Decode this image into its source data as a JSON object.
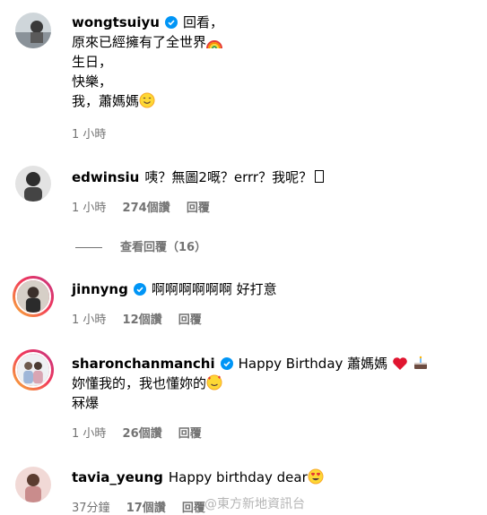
{
  "comments": [
    {
      "username": "wongtsuiyu",
      "verified": true,
      "lines": [
        "回看，",
        "原來已經擁有了全世界",
        "生日，",
        "快樂，",
        "我，蕭媽媽"
      ],
      "time": "1 小時",
      "likes": "",
      "reply": ""
    },
    {
      "username": "edwinsiu",
      "verified": false,
      "text": "咦？無圖2嘅？errr？我呢？",
      "time": "1 小時",
      "likes": "274個讚",
      "reply": "回覆",
      "view_replies": "查看回覆（16）"
    },
    {
      "username": "jinnyng",
      "verified": true,
      "text": "啊啊啊啊啊啊 好打意",
      "time": "1 小時",
      "likes": "12個讚",
      "reply": "回覆"
    },
    {
      "username": "sharonchanmanchi",
      "verified": true,
      "text": "Happy Birthday 蕭媽媽",
      "lines2": [
        "妳懂我的，我也懂妳的",
        "冧爆"
      ],
      "time": "1 小時",
      "likes": "26個讚",
      "reply": "回覆"
    },
    {
      "username": "tavia_yeung",
      "verified": false,
      "text": "Happy birthday dear",
      "time": "37分鐘",
      "likes": "17個讚",
      "reply": "回覆"
    }
  ],
  "watermark": "@東方新地資訊台",
  "colors": {
    "verified": "#0095f6",
    "meta": "#737373"
  },
  "icons": [
    "verified-badge-icon",
    "rainbow-emoji",
    "smile-emoji",
    "heart-emoji",
    "cake-emoji",
    "love-face-emoji",
    "heart-eyes-emoji"
  ]
}
